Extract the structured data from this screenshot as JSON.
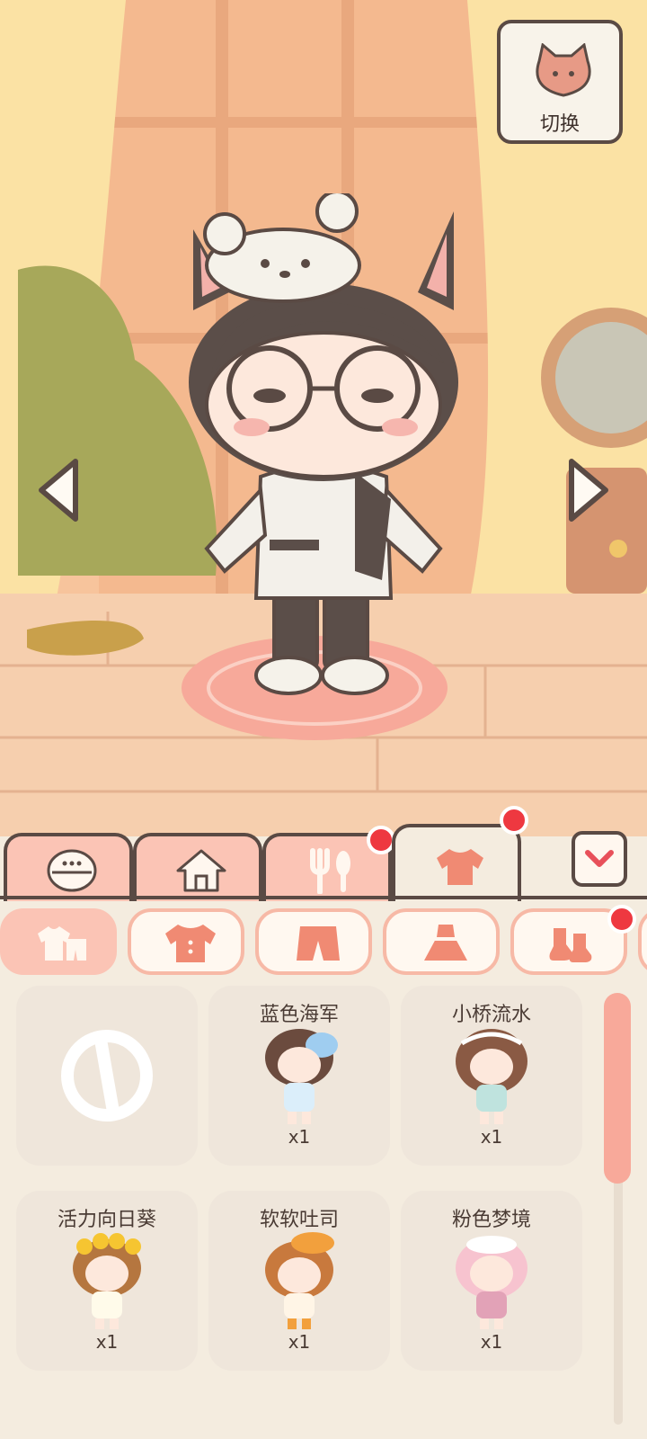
{
  "switch_button": {
    "label": "切换",
    "icon": "cat-face-icon"
  },
  "scene": {
    "character": "boy-with-cat-ears-and-glasses",
    "nav": [
      "prev-arrow-icon",
      "next-arrow-icon"
    ]
  },
  "category_tabs": [
    {
      "icon": "face-icon",
      "active": false,
      "badge": false
    },
    {
      "icon": "house-icon",
      "active": false,
      "badge": false
    },
    {
      "icon": "fork-spoon-icon",
      "active": false,
      "badge": true
    },
    {
      "icon": "shirt-icon",
      "active": true,
      "badge": true
    }
  ],
  "collapse_icon": "chevron-down-icon",
  "subcategories": [
    {
      "icon": "all-clothes-icon",
      "active": true,
      "badge": false
    },
    {
      "icon": "top-icon",
      "active": false,
      "badge": false
    },
    {
      "icon": "pants-icon",
      "active": false,
      "badge": false
    },
    {
      "icon": "dress-icon",
      "active": false,
      "badge": false
    },
    {
      "icon": "socks-icon",
      "active": false,
      "badge": true
    }
  ],
  "outfits": [
    {
      "name": "",
      "qty": "",
      "icon": "none-icon"
    },
    {
      "name": "蓝色海军",
      "qty": "x1"
    },
    {
      "name": "小桥流水",
      "qty": "x1"
    },
    {
      "name": "活力向日葵",
      "qty": "x1"
    },
    {
      "name": "软软吐司",
      "qty": "x1"
    },
    {
      "name": "粉色梦境",
      "qty": "x1"
    }
  ],
  "colors": {
    "accent": "#fbc4b5",
    "outline": "#5a4a44",
    "badge": "#ee3840",
    "card": "#efe6db"
  }
}
